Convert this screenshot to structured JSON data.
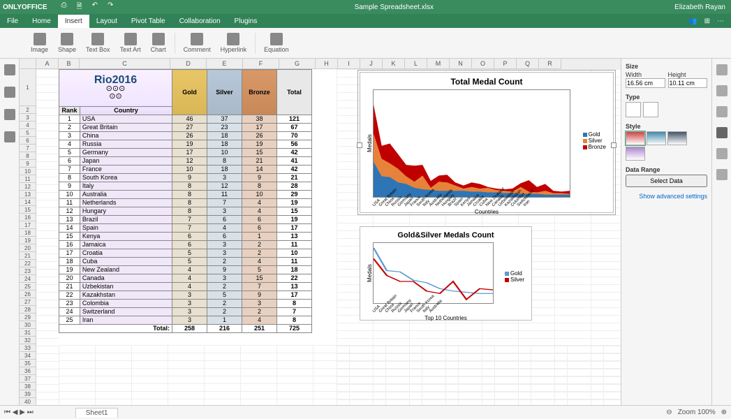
{
  "app": {
    "name": "ONLYOFFICE",
    "filename": "Sample Spreadsheet.xlsx",
    "user": "Elizabeth Rayan"
  },
  "menu": {
    "items": [
      "File",
      "Home",
      "Insert",
      "Layout",
      "Pivot Table",
      "Collaboration",
      "Plugins"
    ],
    "active": "Insert"
  },
  "toolbar": {
    "image": "Image",
    "shape": "Shape",
    "textbox": "Text Box",
    "textart": "Text Art",
    "chart": "Chart",
    "comment": "Comment",
    "hyperlink": "Hyperlink",
    "equation": "Equation"
  },
  "columns": [
    "A",
    "B",
    "C",
    "D",
    "E",
    "F",
    "G",
    "H",
    "I",
    "J",
    "K",
    "L",
    "M",
    "N",
    "O",
    "P",
    "Q",
    "R"
  ],
  "table": {
    "headers": {
      "rank": "Rank",
      "country": "Country",
      "gold": "Gold",
      "silver": "Silver",
      "bronze": "Bronze",
      "total": "Total"
    },
    "logo_text": "Rio2016",
    "rows": [
      {
        "rank": 1,
        "country": "USA",
        "gold": 46,
        "silver": 37,
        "bronze": 38,
        "total": 121
      },
      {
        "rank": 2,
        "country": "Great Britain",
        "gold": 27,
        "silver": 23,
        "bronze": 17,
        "total": 67
      },
      {
        "rank": 3,
        "country": "China",
        "gold": 26,
        "silver": 18,
        "bronze": 26,
        "total": 70
      },
      {
        "rank": 4,
        "country": "Russia",
        "gold": 19,
        "silver": 18,
        "bronze": 19,
        "total": 56
      },
      {
        "rank": 5,
        "country": "Germany",
        "gold": 17,
        "silver": 10,
        "bronze": 15,
        "total": 42
      },
      {
        "rank": 6,
        "country": "Japan",
        "gold": 12,
        "silver": 8,
        "bronze": 21,
        "total": 41
      },
      {
        "rank": 7,
        "country": "France",
        "gold": 10,
        "silver": 18,
        "bronze": 14,
        "total": 42
      },
      {
        "rank": 8,
        "country": "South Korea",
        "gold": 9,
        "silver": 3,
        "bronze": 9,
        "total": 21
      },
      {
        "rank": 9,
        "country": "Italy",
        "gold": 8,
        "silver": 12,
        "bronze": 8,
        "total": 28
      },
      {
        "rank": 10,
        "country": "Australia",
        "gold": 8,
        "silver": 11,
        "bronze": 10,
        "total": 29
      },
      {
        "rank": 11,
        "country": "Netherlands",
        "gold": 8,
        "silver": 7,
        "bronze": 4,
        "total": 19
      },
      {
        "rank": 12,
        "country": "Hungary",
        "gold": 8,
        "silver": 3,
        "bronze": 4,
        "total": 15
      },
      {
        "rank": 13,
        "country": "Brazil",
        "gold": 7,
        "silver": 6,
        "bronze": 6,
        "total": 19
      },
      {
        "rank": 14,
        "country": "Spain",
        "gold": 7,
        "silver": 4,
        "bronze": 6,
        "total": 17
      },
      {
        "rank": 15,
        "country": "Kenya",
        "gold": 6,
        "silver": 6,
        "bronze": 1,
        "total": 13
      },
      {
        "rank": 16,
        "country": "Jamaica",
        "gold": 6,
        "silver": 3,
        "bronze": 2,
        "total": 11
      },
      {
        "rank": 17,
        "country": "Croatia",
        "gold": 5,
        "silver": 3,
        "bronze": 2,
        "total": 10
      },
      {
        "rank": 18,
        "country": "Cuba",
        "gold": 5,
        "silver": 2,
        "bronze": 4,
        "total": 11
      },
      {
        "rank": 19,
        "country": "New Zealand",
        "gold": 4,
        "silver": 9,
        "bronze": 5,
        "total": 18
      },
      {
        "rank": 20,
        "country": "Canada",
        "gold": 4,
        "silver": 3,
        "bronze": 15,
        "total": 22
      },
      {
        "rank": 21,
        "country": "Uzbekistan",
        "gold": 4,
        "silver": 2,
        "bronze": 7,
        "total": 13
      },
      {
        "rank": 22,
        "country": "Kazakhstan",
        "gold": 3,
        "silver": 5,
        "bronze": 9,
        "total": 17
      },
      {
        "rank": 23,
        "country": "Colombia",
        "gold": 3,
        "silver": 2,
        "bronze": 3,
        "total": 8
      },
      {
        "rank": 24,
        "country": "Switzerland",
        "gold": 3,
        "silver": 2,
        "bronze": 2,
        "total": 7
      },
      {
        "rank": 25,
        "country": "Iran",
        "gold": 3,
        "silver": 1,
        "bronze": 4,
        "total": 8
      }
    ],
    "totals": {
      "label": "Total:",
      "gold": 258,
      "silver": 216,
      "bronze": 251,
      "total": 725
    }
  },
  "chart_data": [
    {
      "type": "area",
      "title": "Total Medal Count",
      "xlabel": "Countries",
      "ylabel": "Medals",
      "ylim": [
        0,
        140
      ],
      "categories": [
        "USA",
        "Great Britain",
        "China",
        "Russia",
        "Germany",
        "Japan",
        "France",
        "South Korea",
        "Italy",
        "Australia",
        "Netherlands",
        "Hungary",
        "Brazil",
        "Spain",
        "Kenya",
        "Jamaica",
        "Croatia",
        "Cuba",
        "New Zealand",
        "Canada",
        "Uzbekistan",
        "Kazakhstan",
        "Colombia",
        "Switzerland",
        "Iran"
      ],
      "series": [
        {
          "name": "Gold",
          "color": "#2e75b6",
          "values": [
            46,
            27,
            26,
            19,
            17,
            12,
            10,
            9,
            8,
            8,
            8,
            8,
            7,
            7,
            6,
            6,
            5,
            5,
            4,
            4,
            4,
            3,
            3,
            3,
            3
          ]
        },
        {
          "name": "Silver",
          "color": "#e7823a",
          "values": [
            37,
            23,
            18,
            18,
            10,
            8,
            18,
            3,
            12,
            11,
            7,
            3,
            6,
            4,
            6,
            3,
            3,
            2,
            9,
            3,
            2,
            5,
            2,
            2,
            1
          ]
        },
        {
          "name": "Bronze",
          "color": "#c00000",
          "values": [
            38,
            17,
            26,
            19,
            15,
            21,
            14,
            9,
            8,
            10,
            4,
            4,
            6,
            6,
            1,
            2,
            2,
            4,
            5,
            15,
            7,
            9,
            3,
            2,
            4
          ]
        }
      ]
    },
    {
      "type": "line",
      "title": "Gold&Silver Medals Count",
      "xlabel": "Top 10 Countries",
      "ylabel": "Medals",
      "ylim": [
        0,
        50
      ],
      "categories": [
        "USA",
        "Great Britain",
        "China",
        "Russia",
        "Germany",
        "Japan",
        "France",
        "South Korea",
        "Italy",
        "Australia"
      ],
      "series": [
        {
          "name": "Gold",
          "color": "#5b9bd5",
          "values": [
            46,
            27,
            26,
            19,
            17,
            12,
            10,
            9,
            8,
            8
          ]
        },
        {
          "name": "Silver",
          "color": "#c00000",
          "values": [
            37,
            23,
            18,
            18,
            10,
            8,
            18,
            3,
            12,
            11
          ]
        }
      ]
    }
  ],
  "right_panel": {
    "size_label": "Size",
    "width_label": "Width",
    "height_label": "Height",
    "width": "16.56 cm",
    "height": "10.11 cm",
    "type_label": "Type",
    "style_label": "Style",
    "data_range_label": "Data Range",
    "select_data": "Select Data",
    "advanced": "Show advanced settings"
  },
  "statusbar": {
    "sheet": "Sheet1",
    "zoom": "Zoom 100%"
  }
}
